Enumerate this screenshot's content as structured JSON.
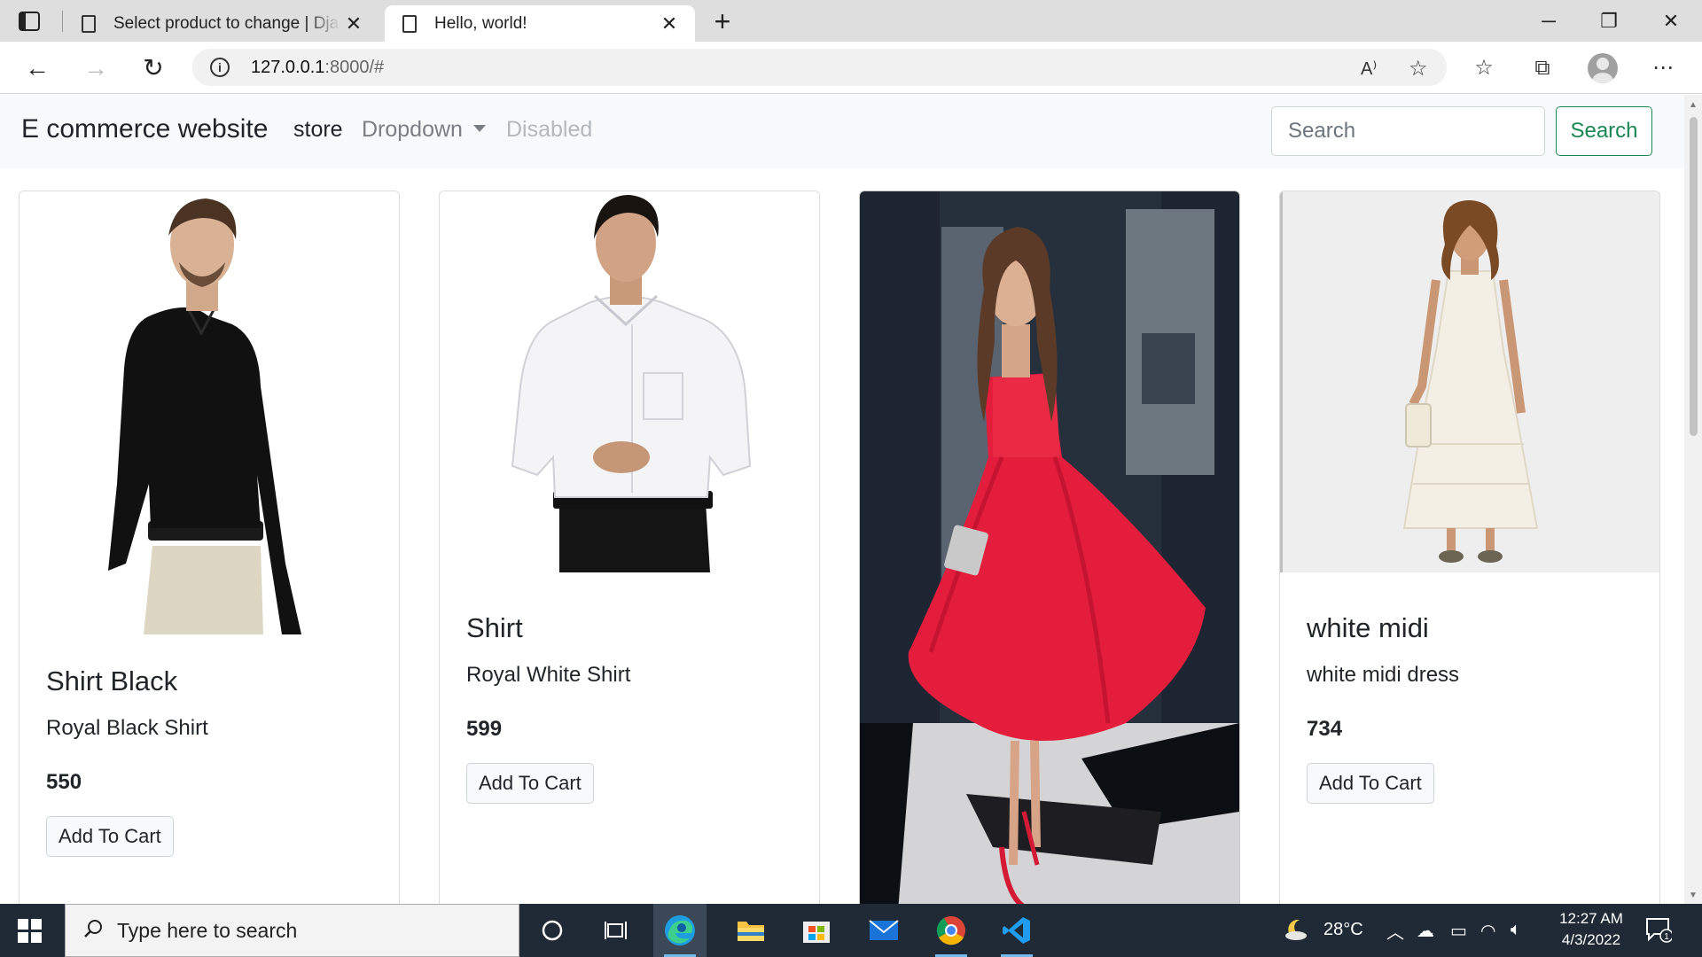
{
  "browser": {
    "tabs": [
      {
        "title": "Select product to change | Django site admin",
        "active": false
      },
      {
        "title": "Hello, world!",
        "active": true
      }
    ],
    "url_host": "127.0.0.1",
    "url_rest": ":8000/#"
  },
  "site": {
    "brand": "E commerce website",
    "nav": {
      "store": "store",
      "dropdown": "Dropdown",
      "disabled": "Disabled"
    },
    "search": {
      "placeholder": "Search",
      "button": "Search"
    }
  },
  "products": [
    {
      "title": "Shirt Black",
      "desc": "Royal Black Shirt",
      "price": "550",
      "button": "Add To Cart"
    },
    {
      "title": "Shirt",
      "desc": "Royal White Shirt",
      "price": "599",
      "button": "Add To Cart"
    },
    {
      "title": "",
      "desc": "",
      "price": "",
      "button": ""
    },
    {
      "title": "white midi",
      "desc": "white midi dress",
      "price": "734",
      "button": "Add To Cart"
    }
  ],
  "taskbar": {
    "search_placeholder": "Type here to search",
    "weather": "28°C",
    "time": "12:27 AM",
    "date": "4/3/2022",
    "notifications": "1"
  },
  "colors": {
    "success": "#198754",
    "navbar_bg": "#f8f9fa",
    "taskbar_bg": "#1f2a36"
  }
}
